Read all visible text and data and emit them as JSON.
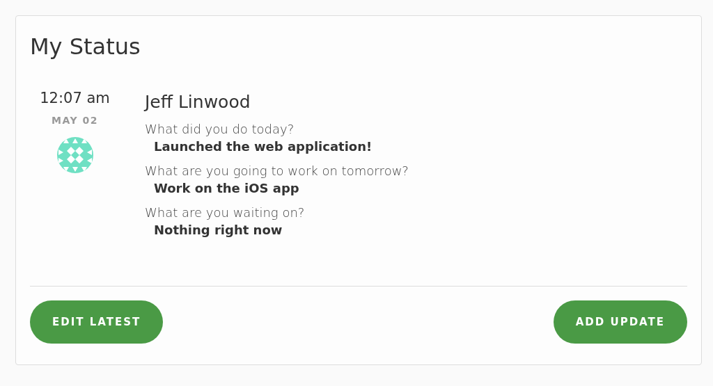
{
  "card": {
    "title": "My Status"
  },
  "status": {
    "time": "12:07 am",
    "date": "MAY 02",
    "name": "Jeff Linwood",
    "answers": [
      {
        "question": "What did you do today?",
        "answer": "Launched the web application!"
      },
      {
        "question": "What are you going to work on tomorrow?",
        "answer": "Work on the iOS app"
      },
      {
        "question": "What are you waiting on?",
        "answer": "Nothing right now"
      }
    ]
  },
  "buttons": [
    {
      "label": "EDIT LATEST"
    },
    {
      "label": "ADD UPDATE"
    }
  ]
}
